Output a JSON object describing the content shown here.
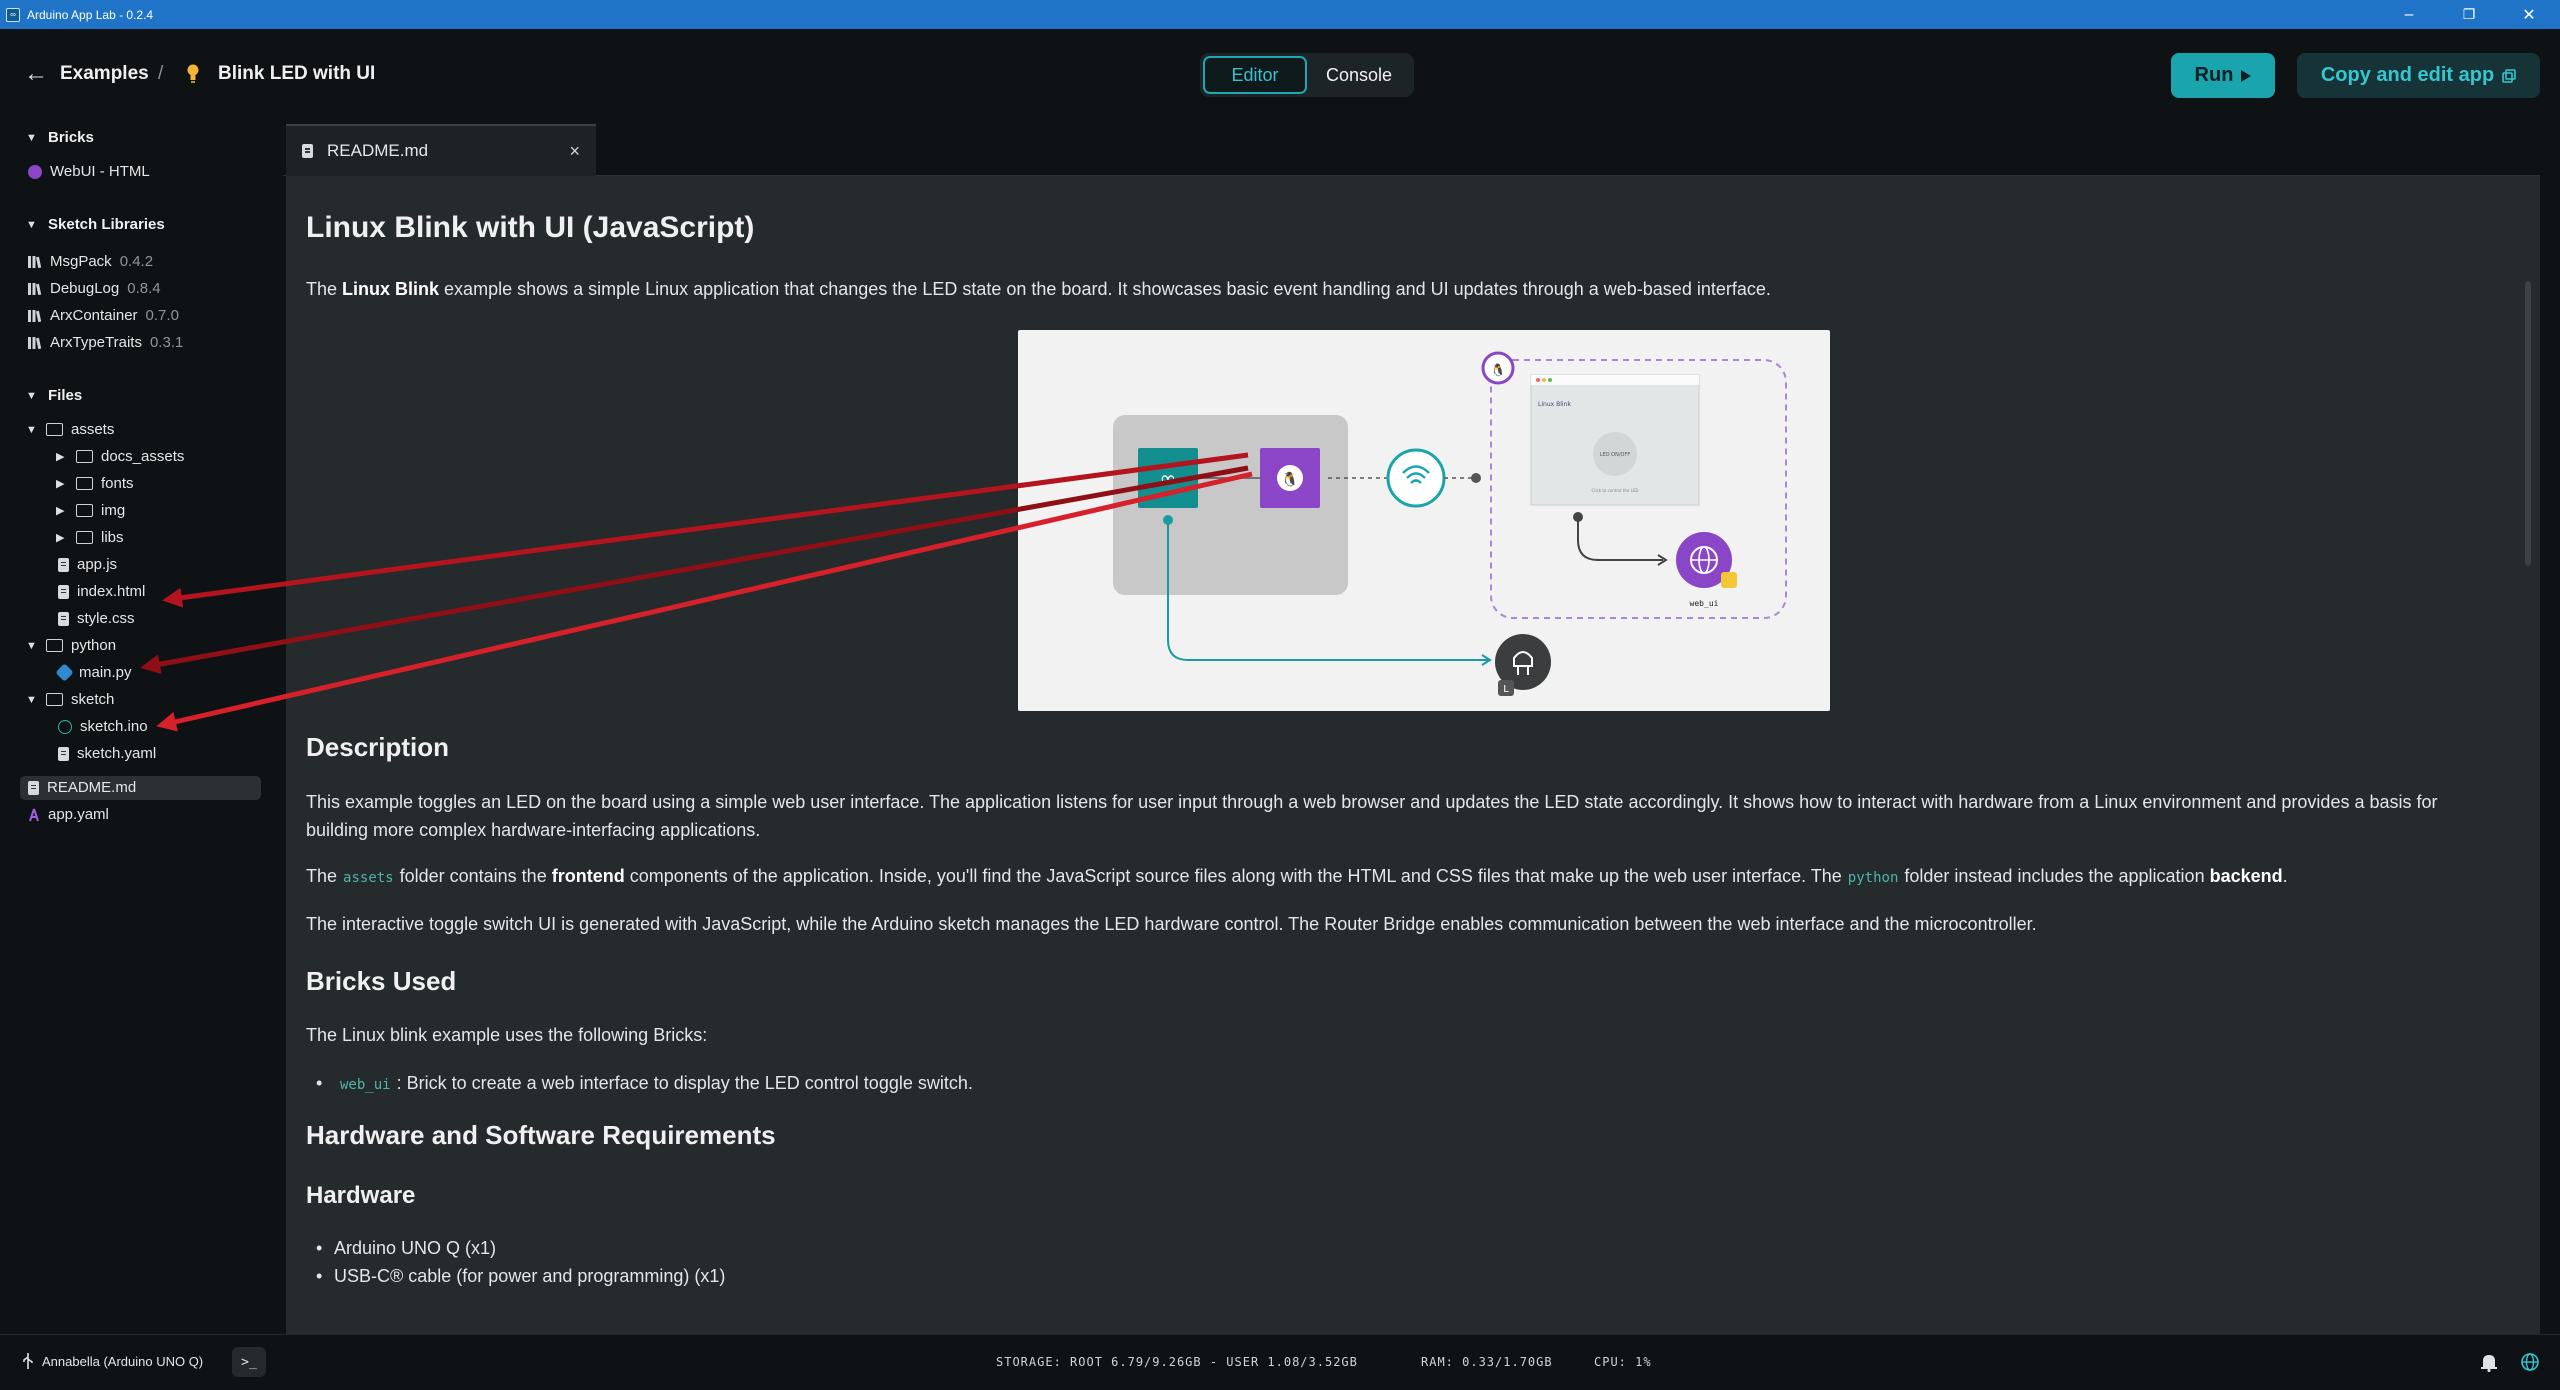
{
  "window": {
    "title": "Arduino App Lab - 0.2.4",
    "minimize": "–",
    "maximize": "❐",
    "close": "✕"
  },
  "header": {
    "back_label": "Examples",
    "separator": "/",
    "title": "Blink LED with UI",
    "tabs": {
      "editor": "Editor",
      "console": "Console"
    },
    "run_label": "Run",
    "copy_label": "Copy and edit app"
  },
  "sidebar": {
    "bricks_title": "Bricks",
    "bricks": [
      {
        "label": "WebUI - HTML"
      }
    ],
    "libraries_title": "Sketch Libraries",
    "libraries": [
      {
        "name": "MsgPack",
        "version": "0.4.2"
      },
      {
        "name": "DebugLog",
        "version": "0.8.4"
      },
      {
        "name": "ArxContainer",
        "version": "0.7.0"
      },
      {
        "name": "ArxTypeTraits",
        "version": "0.3.1"
      }
    ],
    "files_title": "Files",
    "files": {
      "assets": "assets",
      "docs_assets": "docs_assets",
      "fonts": "fonts",
      "img": "img",
      "libs": "libs",
      "app_js": "app.js",
      "index_html": "index.html",
      "style_css": "style.css",
      "python": "python",
      "main_py": "main.py",
      "sketch": "sketch",
      "sketch_ino": "sketch.ino",
      "sketch_yaml": "sketch.yaml",
      "readme": "README.md",
      "app_yaml": "app.yaml"
    }
  },
  "editor": {
    "tab_label": "README.md",
    "tab_close": "×"
  },
  "readme": {
    "title": "Linux Blink with UI (JavaScript)",
    "intro_pre": "The ",
    "intro_bold": "Linux Blink",
    "intro_post": " example shows a simple Linux application that changes the LED state on the board. It showcases basic event handling and UI updates through a web-based interface.",
    "description_title": "Description",
    "description_p1": "This example toggles an LED on the board using a simple web user interface. The application listens for user input through a web browser and updates the LED state accordingly. It shows how to interact with hardware from a Linux environment and provides a basis for building more complex hardware-interfacing applications.",
    "p2_a": "The",
    "p2_code1": "assets",
    "p2_b": "folder contains the ",
    "p2_bold1": "frontend",
    "p2_c": " components of the application. Inside, you'll find the JavaScript source files along with the HTML and CSS files that make up the web user interface. The",
    "p2_code2": "python",
    "p2_d": "folder instead includes the application ",
    "p2_bold2": "backend",
    "p2_e": ".",
    "p3": "The interactive toggle switch UI is generated with JavaScript, while the Arduino sketch manages the LED hardware control. The Router Bridge enables communication between the web interface and the microcontroller.",
    "bricks_title": "Bricks Used",
    "bricks_intro": "The Linux blink example uses the following Bricks:",
    "brick_code": "web_ui",
    "brick_desc": ": Brick to create a web interface to display the LED control toggle switch.",
    "hw_sw_title": "Hardware and Software Requirements",
    "hardware_title": "Hardware",
    "hardware_items": [
      "Arduino UNO Q (x1)",
      "USB-C® cable (for power and programming) (x1)"
    ]
  },
  "diagram": {
    "browser_title": "Linux Blink",
    "led_button": "LED ON/OFF",
    "browser_caption": "Click to control the LED",
    "web_ui_label": "web_ui",
    "led_letter": "L"
  },
  "status": {
    "board": "Annabella (Arduino UNO Q)",
    "terminal": ">_",
    "storage": "STORAGE: ROOT 6.79/9.26GB - USER 1.08/3.52GB",
    "ram": "RAM: 0.33/1.70GB",
    "cpu": "CPU: 1%"
  },
  "colors": {
    "accent": "#1aa4ae",
    "arrow_red": "#d6202a",
    "arrow_dark": "#8e0f16",
    "brick_purple": "#8b46c8"
  }
}
